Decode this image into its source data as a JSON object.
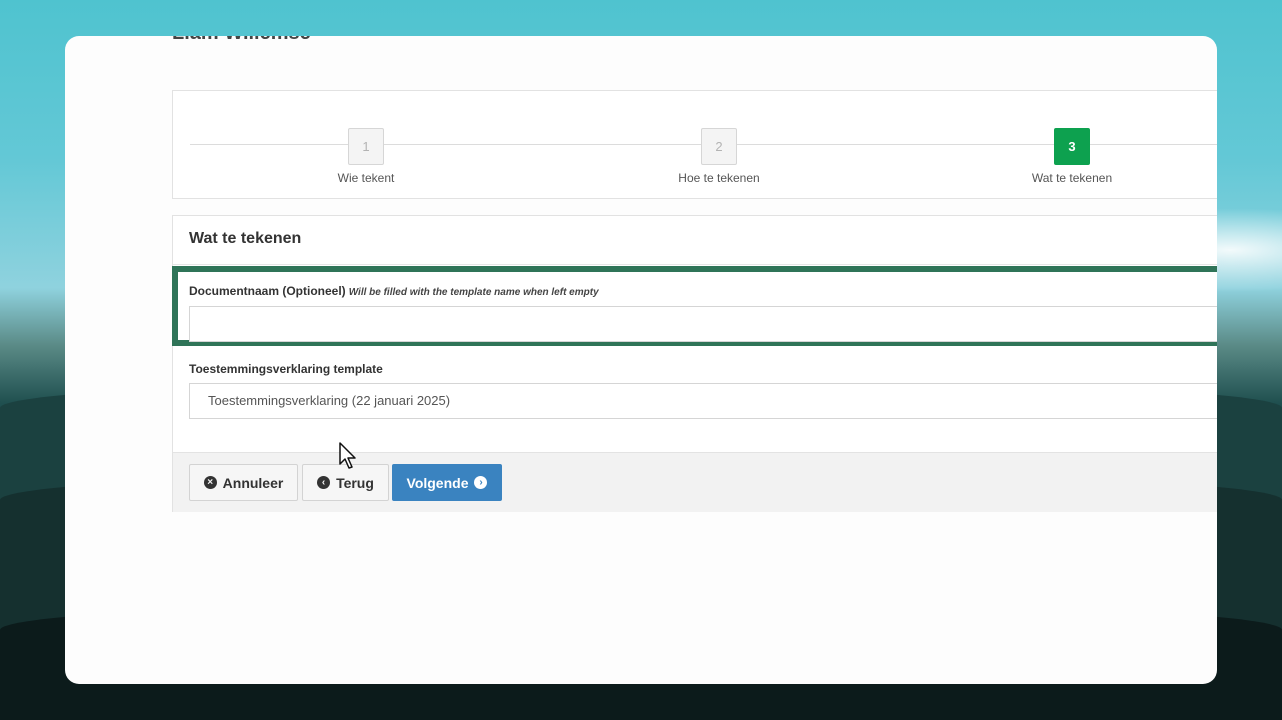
{
  "page": {
    "title": "Liam Willemse"
  },
  "stepper": {
    "steps": [
      {
        "number": "1",
        "label": "Wie tekent"
      },
      {
        "number": "2",
        "label": "Hoe te tekenen"
      },
      {
        "number": "3",
        "label": "Wat te tekenen"
      }
    ],
    "active_step": 3
  },
  "panel": {
    "title": "Wat te tekenen",
    "document_name": {
      "label": "Documentnaam (Optioneel)",
      "hint": "Will be filled with the template name when left empty",
      "value": ""
    },
    "template": {
      "label": "Toestemmingsverklaring template",
      "value": "Toestemmingsverklaring (22 januari 2025)"
    }
  },
  "footer": {
    "cancel_label": "Annuleer",
    "back_label": "Terug",
    "next_label": "Volgende"
  },
  "icons": {
    "cancel": "times-circle-icon",
    "back": "arrow-left-circle-icon",
    "next": "arrow-right-circle-icon"
  },
  "colors": {
    "active_step": "#0da14f",
    "highlight": "#2f7458",
    "primary_button": "#3a83c0"
  }
}
